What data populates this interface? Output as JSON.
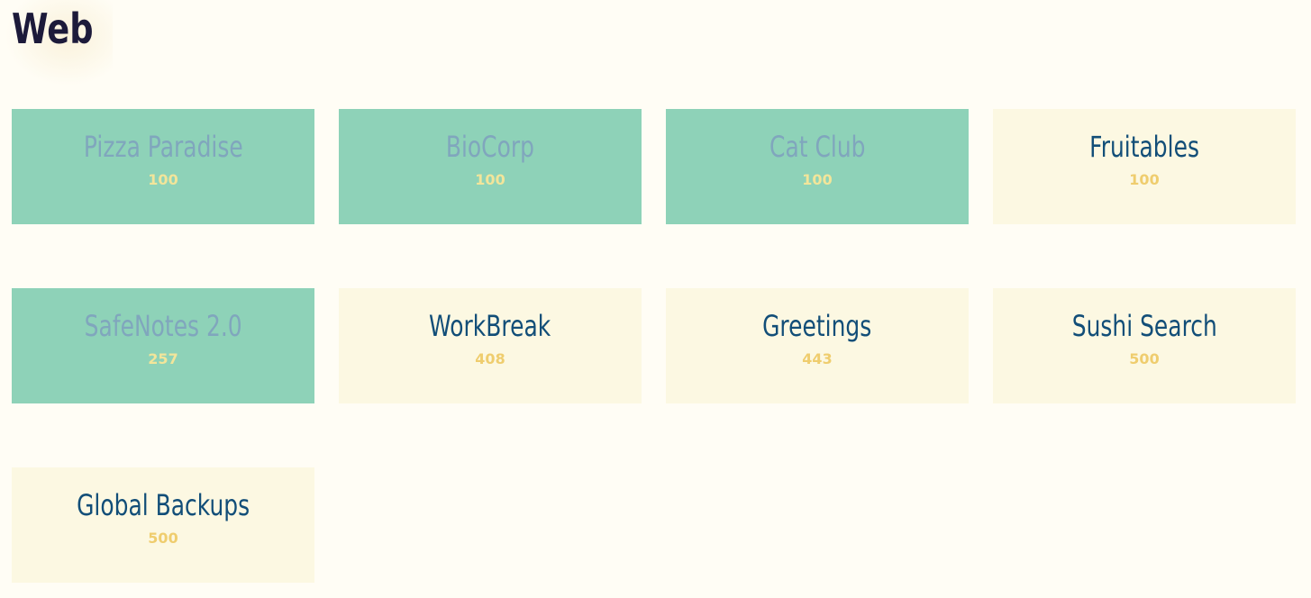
{
  "category": {
    "title": "Web"
  },
  "colors": {
    "background": "#fffdf5",
    "solved_card": "#8ed2b8",
    "unsolved_card": "#fcf8e2",
    "solved_name": "#80a6bd",
    "unsolved_name": "#124e78",
    "solved_points": "#f2e59a",
    "unsolved_points": "#efcd6e",
    "title": "#1c1a3a"
  },
  "challenges": [
    {
      "name": "Pizza Paradise",
      "points": "100",
      "solved": true
    },
    {
      "name": "BioCorp",
      "points": "100",
      "solved": true
    },
    {
      "name": "Cat Club",
      "points": "100",
      "solved": true
    },
    {
      "name": "Fruitables",
      "points": "100",
      "solved": false
    },
    {
      "name": "SafeNotes 2.0",
      "points": "257",
      "solved": true
    },
    {
      "name": "WorkBreak",
      "points": "408",
      "solved": false
    },
    {
      "name": "Greetings",
      "points": "443",
      "solved": false
    },
    {
      "name": "Sushi Search",
      "points": "500",
      "solved": false
    },
    {
      "name": "Global Backups",
      "points": "500",
      "solved": false
    }
  ]
}
